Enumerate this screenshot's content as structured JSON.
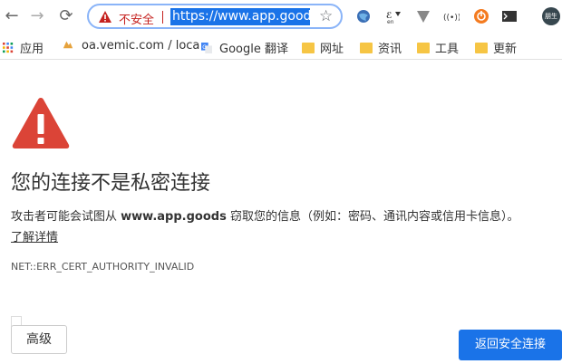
{
  "toolbar": {
    "back_icon": "←",
    "forward_icon": "→",
    "reload_icon": "⟳",
    "security_label": "不安全",
    "url": "https://www.app.goods",
    "star_icon": "☆",
    "extensions": [
      "globe-icon",
      "translate-icon",
      "vivaldi-icon",
      "cast-icon",
      "power-icon",
      "terminal-icon"
    ],
    "avatar_label": "朋生"
  },
  "bookmarks": {
    "apps_label": "应用",
    "items": [
      {
        "label": "oa.vemic.com / loca",
        "icon": "pma-icon"
      },
      {
        "label": "Google 翻译",
        "icon": "google-translate-icon"
      },
      {
        "label": "网址",
        "icon": "folder-icon"
      },
      {
        "label": "资讯",
        "icon": "folder-icon"
      },
      {
        "label": "工具",
        "icon": "folder-icon"
      },
      {
        "label": "更新",
        "icon": "folder-icon"
      }
    ]
  },
  "interstitial": {
    "heading": "您的连接不是私密连接",
    "desc_prefix": "攻击者可能会试图从 ",
    "desc_host": "www.app.goods",
    "desc_suffix": " 窃取您的信息（例如：密码、通讯内容或信用卡信息）。",
    "details_link": "了解详情",
    "error_code": "NET::ERR_CERT_AUTHORITY_INVALID",
    "advanced_button": "高级",
    "back_button": "返回安全连接"
  },
  "colors": {
    "accent": "#1a73e8",
    "danger": "#db4437",
    "folder": "#f6c544"
  }
}
